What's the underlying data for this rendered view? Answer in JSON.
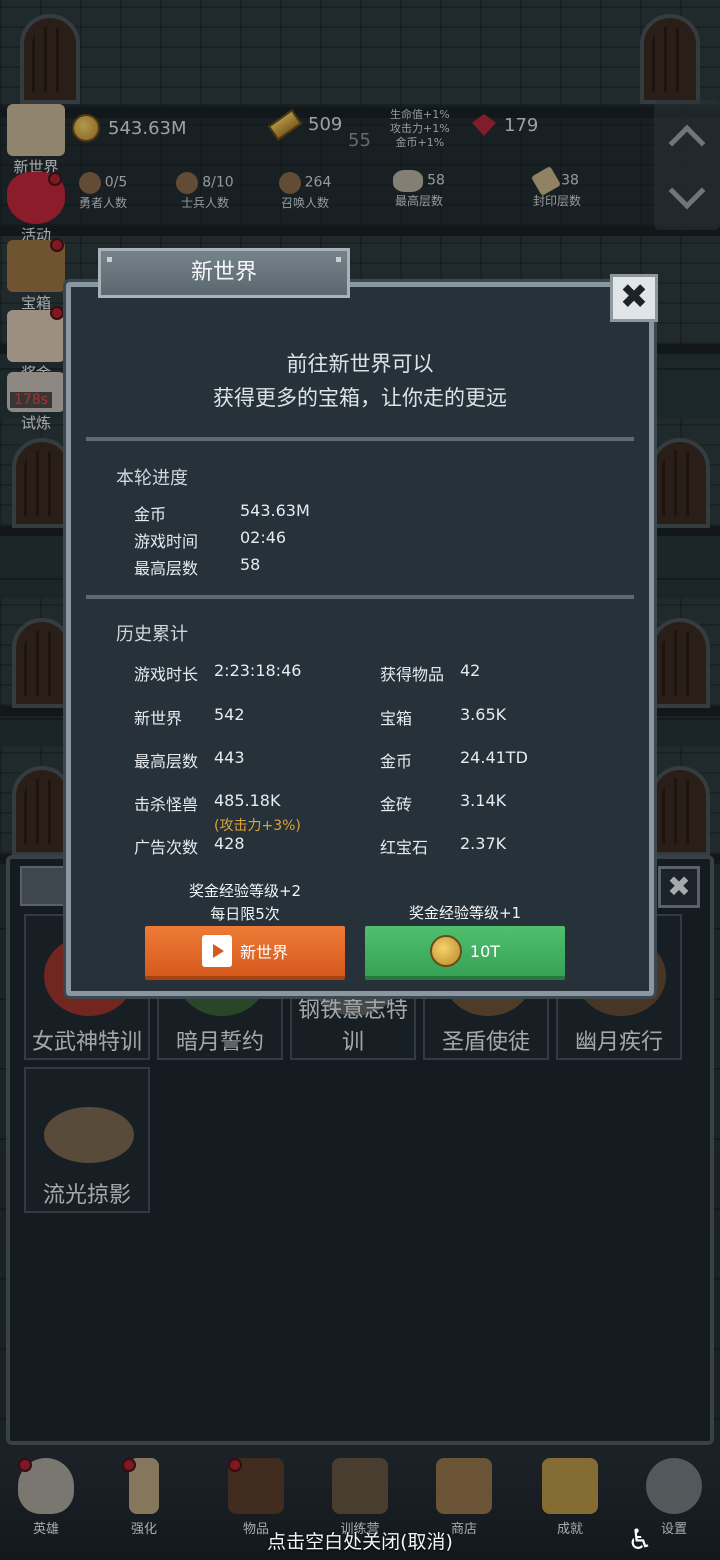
{
  "resources": {
    "gold": "543.63M",
    "gold_bars": "509",
    "ruby": "179",
    "level": "55",
    "buffs": [
      "生命值+1%",
      "攻击力+1%",
      "金币+1%"
    ]
  },
  "stats": [
    {
      "value": "0/5",
      "label": "勇者人数"
    },
    {
      "value": "8/10",
      "label": "士兵人数"
    },
    {
      "value": "264",
      "label": "召唤人数"
    },
    {
      "value": "58",
      "label": "最高层数"
    },
    {
      "value": "38",
      "label": "封印层数"
    }
  ],
  "side_menu": [
    "新世界",
    "活动",
    "宝箱",
    "奖金",
    "试炼"
  ],
  "trial_timer": "178s",
  "dialog": {
    "title": "新世界",
    "close": "✖",
    "intro_line1": "前往新世界可以",
    "intro_line2": "获得更多的宝箱，让你走的更远",
    "round_title": "本轮进度",
    "round": [
      {
        "k": "金币",
        "v": "543.63M"
      },
      {
        "k": "游戏时间",
        "v": "02:46"
      },
      {
        "k": "最高层数",
        "v": "58"
      }
    ],
    "history_title": "历史累计",
    "history_left": [
      {
        "k": "游戏时长",
        "v": "2:23:18:46"
      },
      {
        "k": "新世界",
        "v": "542"
      },
      {
        "k": "最高层数",
        "v": "443"
      },
      {
        "k": "击杀怪兽",
        "v": "485.18K"
      },
      {
        "k": "广告次数",
        "v": "428"
      }
    ],
    "history_right": [
      {
        "k": "获得物品",
        "v": "42"
      },
      {
        "k": "宝箱",
        "v": "3.65K"
      },
      {
        "k": "金币",
        "v": "24.41TD"
      },
      {
        "k": "金砖",
        "v": "3.14K"
      },
      {
        "k": "红宝石",
        "v": "2.37K"
      }
    ],
    "kill_bonus": "(攻击力+3%)",
    "ad_note1": "奖金经验等级+2",
    "ad_note2": "每日限5次",
    "coin_note": "奖金经验等级+1",
    "ad_button": "新世界",
    "coin_button": "10T"
  },
  "cards": [
    "女武神特训",
    "暗月誓约",
    "钢铁意志特训",
    "圣盾使徒",
    "幽月疾行",
    "流光掠影"
  ],
  "nav": [
    "英雄",
    "强化",
    "物品",
    "训练营",
    "商店",
    "成就",
    "设置"
  ],
  "hint": "点击空白处关闭(取消)",
  "colors": {
    "ad_button": "#e26a2a",
    "coin_button": "#43b062",
    "bonus_text": "#d9a53a"
  }
}
